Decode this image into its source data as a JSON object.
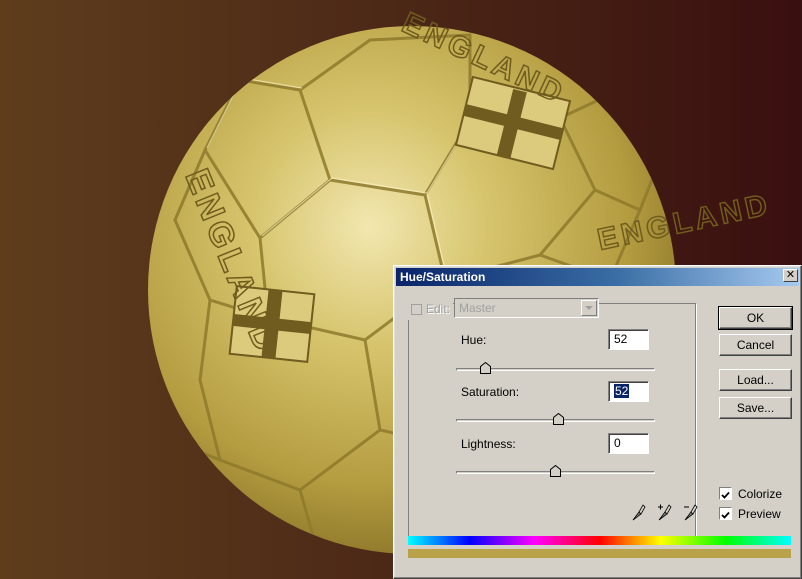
{
  "dialog": {
    "title": "Hue/Saturation",
    "close_symbol": "✕",
    "edit": {
      "label": "Edit:",
      "selected": "Master"
    },
    "hue": {
      "label": "Hue:",
      "value": "52",
      "fraction": 0.2
    },
    "saturation": {
      "label": "Saturation:",
      "value": "52",
      "fraction": 0.51
    },
    "lightness": {
      "label": "Lightness:",
      "value": "0",
      "fraction": 0.5
    },
    "buttons": {
      "ok": "OK",
      "cancel": "Cancel",
      "load": "Load...",
      "save": "Save..."
    },
    "colorize": {
      "label": "Colorize",
      "checked": true
    },
    "preview": {
      "label": "Preview",
      "checked": true
    },
    "eyedroppers": [
      "eyedropper-icon",
      "eyedropper-plus-icon",
      "eyedropper-minus-icon"
    ],
    "result_color": "#b9a24a"
  },
  "canvas": {
    "ball_text": [
      "ENGLAND",
      "ENGLAND",
      "ENGLAND"
    ],
    "background_left": "#5e3d1d",
    "background_right": "#3a0f0f",
    "ball_color": "#c8b45a"
  }
}
